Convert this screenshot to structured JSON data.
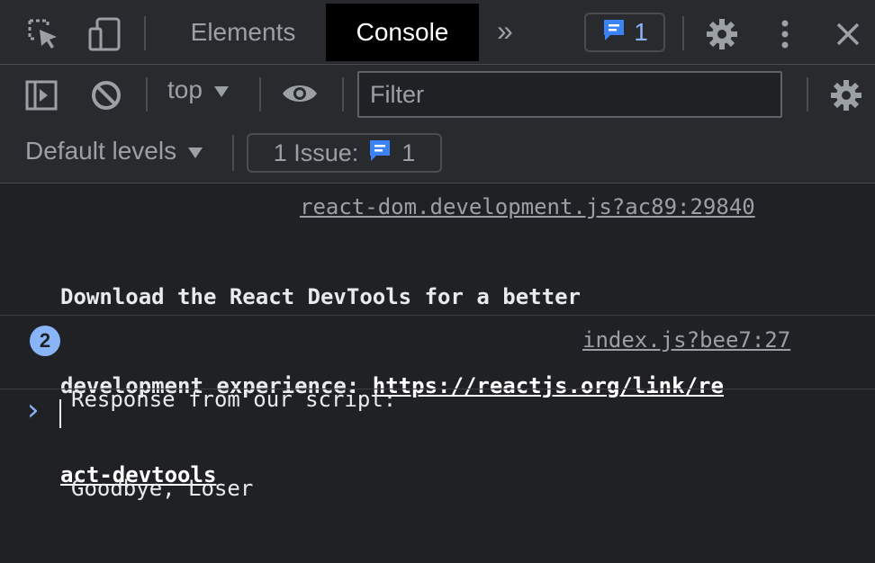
{
  "tabs": {
    "elements": "Elements",
    "console": "Console",
    "more": "»"
  },
  "messages_badge": {
    "count": "1"
  },
  "toolbar": {
    "context": "top",
    "filter_placeholder": "Filter",
    "levels": "Default levels",
    "issues_label": "1 Issue:",
    "issues_count": "1"
  },
  "console": {
    "messages": [
      {
        "source": "react-dom.development.js?ac89:29840",
        "text_line1": "Download the React DevTools for a better",
        "text_line2_prefix": "development experience: ",
        "link_part1": "https://reactjs.org/link/re",
        "link_part2": "act-devtools"
      },
      {
        "repeat_count": "2",
        "source": "index.js?bee7:27",
        "text_line1": "Response from our script:",
        "text_line2": "Goodbye, Loser"
      }
    ],
    "prompt": "›"
  },
  "colors": {
    "accent": "#8ab4f8",
    "background": "#202124",
    "toolbar": "#292a2d"
  },
  "icons": [
    "inspect-icon",
    "device-toggle-icon",
    "more-tabs-icon",
    "message-icon",
    "settings-icon",
    "kebab-menu-icon",
    "close-icon",
    "sidebar-toggle-icon",
    "clear-console-icon",
    "dropdown-arrow-icon",
    "eye-icon",
    "issue-icon",
    "prompt-chevron-icon"
  ]
}
